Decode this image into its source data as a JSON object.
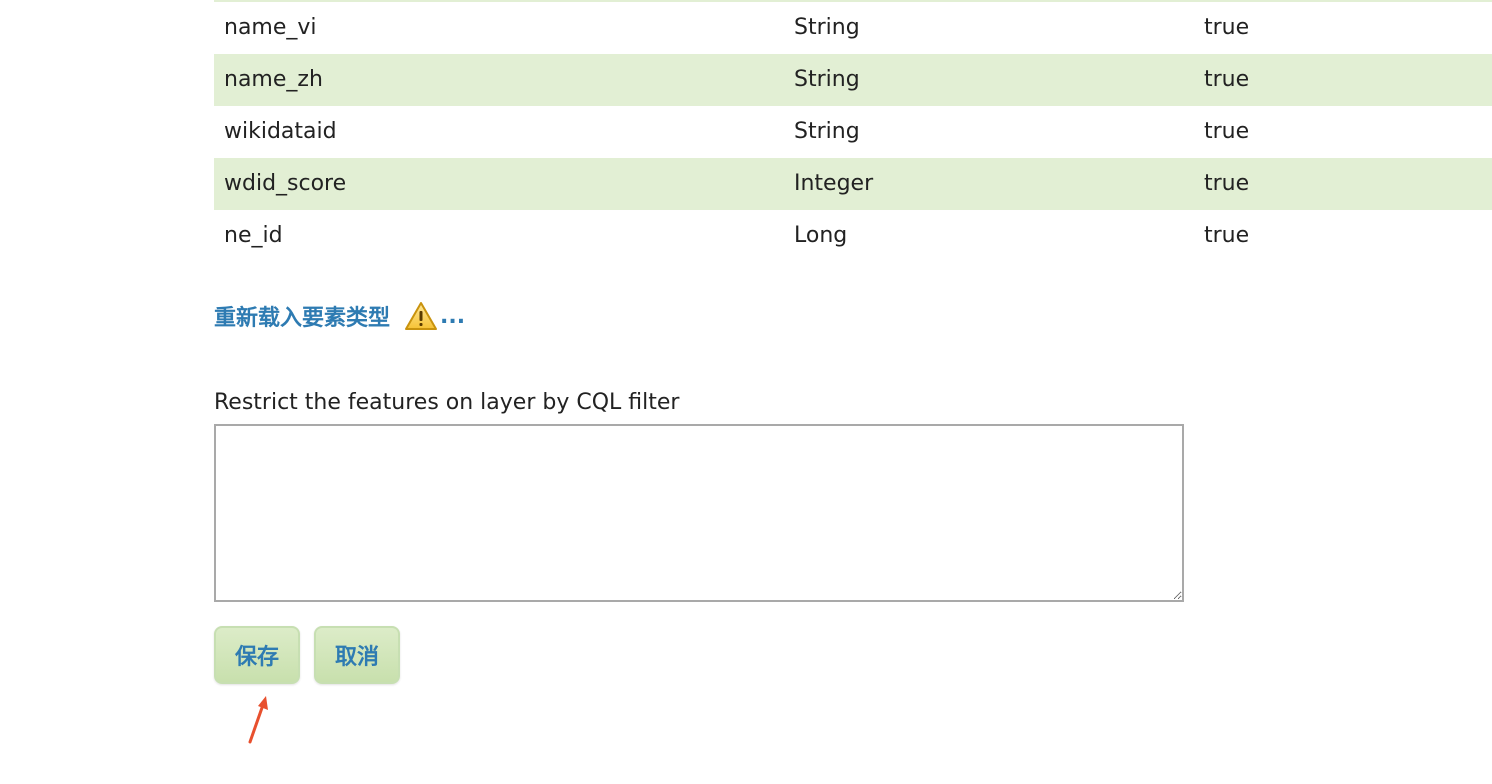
{
  "attributes": {
    "rows": [
      {
        "name": "name_vi",
        "type": "String",
        "nillable": "true"
      },
      {
        "name": "name_zh",
        "type": "String",
        "nillable": "true"
      },
      {
        "name": "wikidataid",
        "type": "String",
        "nillable": "true"
      },
      {
        "name": "wdid_score",
        "type": "Integer",
        "nillable": "true"
      },
      {
        "name": "ne_id",
        "type": "Long",
        "nillable": "true"
      }
    ]
  },
  "reload": {
    "label": "重新载入要素类型",
    "ellipsis": "...",
    "icon": "warning-icon"
  },
  "cql": {
    "label": "Restrict the features on layer by CQL filter",
    "value": ""
  },
  "buttons": {
    "save_label": "保存",
    "cancel_label": "取消"
  },
  "colors": {
    "row_alt": "#e2efd4",
    "link": "#2e7bb2",
    "annotation_arrow": "#e8502e"
  }
}
